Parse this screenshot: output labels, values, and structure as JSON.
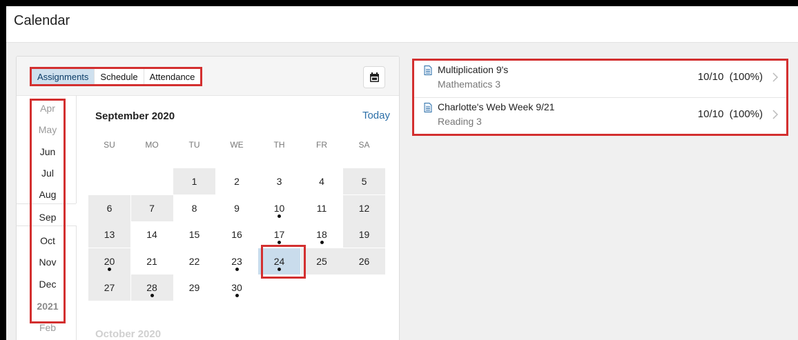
{
  "app": {
    "title": "Calendar"
  },
  "tabs": [
    {
      "label": "Assignments",
      "active": true
    },
    {
      "label": "Schedule",
      "active": false
    },
    {
      "label": "Attendance",
      "active": false
    }
  ],
  "toolbar": {
    "calendar_icon": "calendar-icon"
  },
  "months": [
    {
      "label": "Apr",
      "style": "dim"
    },
    {
      "label": "May",
      "style": "dim"
    },
    {
      "label": "Jun",
      "style": "normal"
    },
    {
      "label": "Jul",
      "style": "normal"
    },
    {
      "label": "Aug",
      "style": "normal"
    },
    {
      "label": "Sep",
      "style": "normal"
    },
    {
      "label": "Oct",
      "style": "normal"
    },
    {
      "label": "Nov",
      "style": "normal"
    },
    {
      "label": "Dec",
      "style": "normal"
    },
    {
      "label": "2021",
      "style": "bold"
    },
    {
      "label": "Feb",
      "style": "dim"
    }
  ],
  "calendar": {
    "month_title": "September 2020",
    "today_label": "Today",
    "next_month_title": "October 2020",
    "weekdays": [
      "SU",
      "MO",
      "TU",
      "WE",
      "TH",
      "FR",
      "SA"
    ],
    "weeks": [
      [
        null,
        null,
        {
          "d": "1",
          "shade": true
        },
        {
          "d": "2"
        },
        {
          "d": "3"
        },
        {
          "d": "4"
        },
        {
          "d": "5",
          "shade": true
        }
      ],
      [
        {
          "d": "6",
          "shade": true
        },
        {
          "d": "7",
          "shade": true
        },
        {
          "d": "8"
        },
        {
          "d": "9"
        },
        {
          "d": "10",
          "dot": true
        },
        {
          "d": "11"
        },
        {
          "d": "12",
          "shade": true
        }
      ],
      [
        {
          "d": "13",
          "shade": true
        },
        {
          "d": "14"
        },
        {
          "d": "15"
        },
        {
          "d": "16"
        },
        {
          "d": "17",
          "dot": true
        },
        {
          "d": "18",
          "dot": true
        },
        {
          "d": "19",
          "shade": true
        }
      ],
      [
        {
          "d": "20",
          "dot": true,
          "shade": true
        },
        {
          "d": "21"
        },
        {
          "d": "22"
        },
        {
          "d": "23",
          "dot": true
        },
        {
          "d": "24",
          "dot": true,
          "selected": true
        },
        {
          "d": "25",
          "shade": true
        },
        {
          "d": "26",
          "shade": true
        }
      ],
      [
        {
          "d": "27",
          "shade": true
        },
        {
          "d": "28",
          "dot": true,
          "shade": true
        },
        {
          "d": "29"
        },
        {
          "d": "30",
          "dot": true
        },
        null,
        null,
        null
      ]
    ],
    "selected_day": "24"
  },
  "assignments": [
    {
      "name": "Multiplication 9's",
      "course": "Mathematics 3",
      "score": "10/10  (100%)",
      "icon": "document-icon"
    },
    {
      "name": "Charlotte's Web Week 9/21",
      "course": "Reading 3",
      "score": "10/10  (100%)",
      "icon": "document-icon"
    }
  ],
  "colors": {
    "highlight_red": "#d32f2f",
    "accent_blue": "#2c6fa8",
    "active_tab_bg": "#cfe0ee",
    "selected_day_bg": "#c9dcec"
  }
}
